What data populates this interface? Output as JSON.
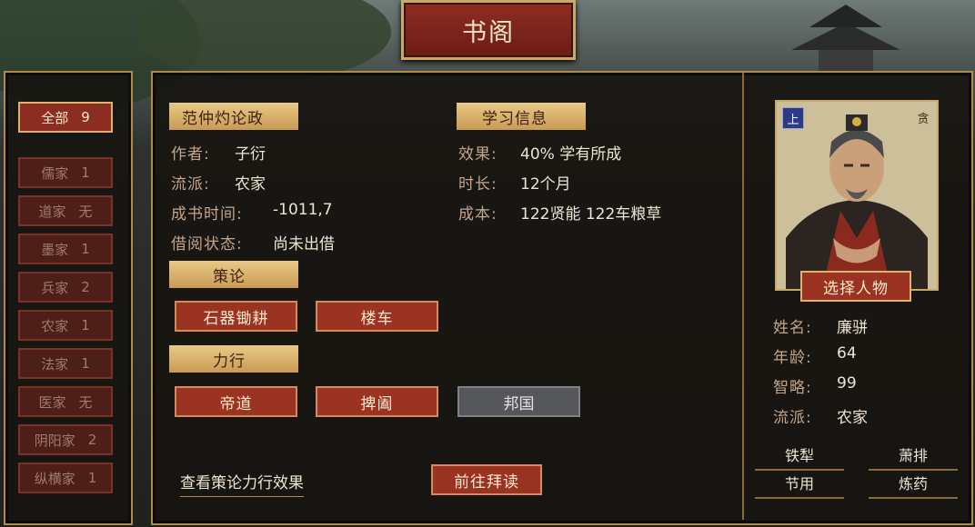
{
  "title": "书阁",
  "categories": [
    {
      "name": "全部",
      "count": "9",
      "active": true
    },
    {
      "name": "儒家",
      "count": "1"
    },
    {
      "name": "道家",
      "count": "无"
    },
    {
      "name": "墨家",
      "count": "1"
    },
    {
      "name": "兵家",
      "count": "2"
    },
    {
      "name": "农家",
      "count": "1"
    },
    {
      "name": "法家",
      "count": "1"
    },
    {
      "name": "医家",
      "count": "无"
    },
    {
      "name": "阴阳家",
      "count": "2"
    },
    {
      "name": "纵横家",
      "count": "1"
    }
  ],
  "book": {
    "title": "范仲灼论政",
    "author_label": "作者:",
    "author": "子衍",
    "school_label": "流派:",
    "school": "农家",
    "time_label": "成书时间:",
    "time": "-1011,7",
    "borrow_label": "借阅状态:",
    "borrow": "尚未出借"
  },
  "study": {
    "title": "学习信息",
    "effect_label": "效果:",
    "effect": "40%  学有所成",
    "duration_label": "时长:",
    "duration": "12个月",
    "cost_label": "成本:",
    "cost": "122贤能  122车粮草"
  },
  "celun": {
    "title": "策论",
    "items": [
      "石器锄耕",
      "楼车"
    ]
  },
  "lixing": {
    "title": "力行",
    "items": [
      "帝道",
      "捭阖",
      "邦国"
    ]
  },
  "view_effects": "查看策论力行效果",
  "goto_read": "前往拜读",
  "character": {
    "badge_left": "上",
    "badge_right": "贪",
    "select": "选择人物",
    "name_label": "姓名:",
    "name": "廉骈",
    "age_label": "年龄:",
    "age": "64",
    "wit_label": "智略:",
    "wit": "99",
    "school_label": "流派:",
    "school": "农家",
    "traits": [
      "铁犁",
      "萧排",
      "节用",
      "炼药"
    ]
  }
}
